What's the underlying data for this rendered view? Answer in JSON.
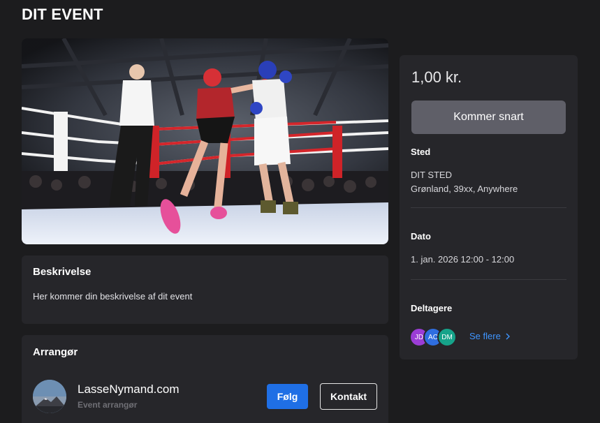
{
  "page": {
    "title": "DIT EVENT"
  },
  "description": {
    "heading": "Beskrivelse",
    "text": "Her kommer din beskrivelse af dit event"
  },
  "organizer": {
    "heading": "Arrangør",
    "name": "LasseNymand.com",
    "role": "Event arrangør",
    "follow_label": "Følg",
    "contact_label": "Kontakt"
  },
  "sidebar": {
    "price": "1,00 kr.",
    "cta_label": "Kommer snart",
    "location_label": "Sted",
    "location_name": "DIT STED",
    "location_address": "Grønland, 39xx, Anywhere",
    "date_label": "Dato",
    "date_value": "1. jan. 2026 12:00 - 12:00",
    "participants_label": "Deltagere",
    "participants": [
      {
        "initials": "JD",
        "color": "#9b3dd6"
      },
      {
        "initials": "AC",
        "color": "#2f6ee0"
      },
      {
        "initials": "DM",
        "color": "#16a38a"
      }
    ],
    "see_more_label": "Se flere"
  },
  "colors": {
    "background": "#1c1c1e",
    "card": "#26262a",
    "primary_button": "#1f6fe5",
    "link": "#3f95ff",
    "disabled_button": "#5f5f68"
  }
}
